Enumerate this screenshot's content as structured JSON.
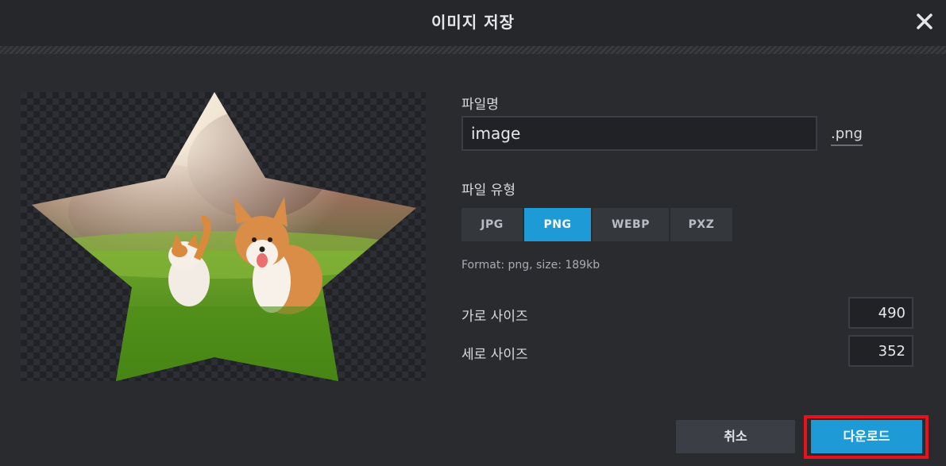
{
  "dialog": {
    "title": "이미지 저장",
    "close_icon": "close-icon"
  },
  "filename": {
    "label": "파일명",
    "value": "image",
    "extension": ".png"
  },
  "filetype": {
    "label": "파일 유형",
    "options": [
      "JPG",
      "PNG",
      "WEBP",
      "PXZ"
    ],
    "selected": "PNG",
    "format_info": "Format: png, size: 189kb"
  },
  "size": {
    "width_label": "가로 사이즈",
    "width_value": "490",
    "height_label": "세로 사이즈",
    "height_value": "352"
  },
  "actions": {
    "cancel_label": "취소",
    "download_label": "다운로드"
  },
  "colors": {
    "accent": "#1e9ad6",
    "highlight_outline": "#e8121e",
    "background": "#292b2f"
  }
}
